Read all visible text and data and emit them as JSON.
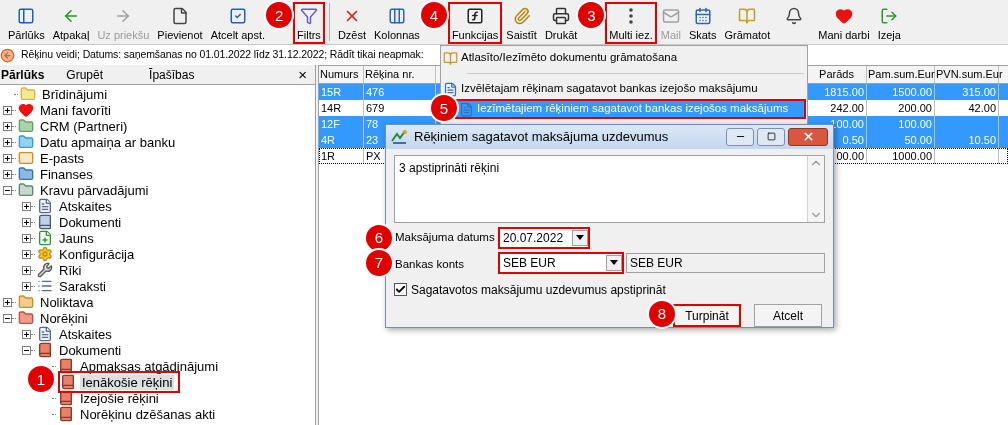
{
  "toolbar": {
    "items": [
      {
        "kind": "button",
        "label": "Pārlūks",
        "disabled": false
      },
      {
        "kind": "button",
        "label": "Atpakaļ",
        "disabled": false
      },
      {
        "kind": "button",
        "label": "Uz priekšu",
        "disabled": true
      },
      {
        "kind": "button",
        "label": "Pievienot",
        "disabled": false
      },
      {
        "kind": "button",
        "label": "Atcelt apst.",
        "disabled": false
      },
      {
        "kind": "button",
        "label": "Filtrs",
        "disabled": false,
        "callout": "2"
      },
      {
        "kind": "separator"
      },
      {
        "kind": "button",
        "label": "Dzēst",
        "disabled": false
      },
      {
        "kind": "button",
        "label": "Kolonnas",
        "disabled": false
      },
      {
        "kind": "button",
        "label": "Funkcijas",
        "disabled": false,
        "callout": "4"
      },
      {
        "kind": "button",
        "label": "Saistīt",
        "disabled": false
      },
      {
        "kind": "button",
        "label": "Drukāt",
        "disabled": false
      },
      {
        "kind": "button",
        "label": "Multi iez.",
        "disabled": false,
        "callout": "3"
      },
      {
        "kind": "button",
        "label": "Mail",
        "disabled": true
      },
      {
        "kind": "button",
        "label": "Skats",
        "disabled": false
      },
      {
        "kind": "button",
        "label": "Grāmatot",
        "disabled": false
      },
      {
        "kind": "icon_button",
        "disabled": false
      },
      {
        "kind": "button",
        "label": "Mani darbi",
        "disabled": false
      },
      {
        "kind": "button",
        "label": "Izeja",
        "disabled": false
      }
    ]
  },
  "filter_bar": {
    "text": "Rēķinu veidi; Datums: saņemšanas no 01.01.2022 līdz 31.12.2022; Rādīt tikai neapmak:"
  },
  "sidebar": {
    "tabs": [
      {
        "label": "Pārlūks",
        "selected": true
      },
      {
        "label": "Grupēt",
        "selected": false
      },
      {
        "label": "Īpašības",
        "selected": false
      }
    ],
    "close": "×",
    "tree": [
      {
        "label": "Brīdinājumi",
        "selected": false
      },
      {
        "label": "Mani favorīti",
        "expanded": false,
        "selected": false
      },
      {
        "label": "CRM (Partneri)",
        "expanded": false,
        "selected": false
      },
      {
        "label": "Datu apmaiņa ar banku",
        "expanded": false,
        "selected": false
      },
      {
        "label": "E-pasts",
        "expanded": false,
        "selected": false
      },
      {
        "label": "Finanses",
        "expanded": false,
        "selected": false
      },
      {
        "label": "Kravu pārvadājumi",
        "expanded": true,
        "selected": false,
        "children": [
          {
            "label": "Atskaites",
            "expanded": false,
            "selected": false
          },
          {
            "label": "Dokumenti",
            "expanded": false,
            "selected": false
          },
          {
            "label": "Jauns",
            "expanded": false,
            "selected": false
          },
          {
            "label": "Konfigurācija",
            "expanded": false,
            "selected": false
          },
          {
            "label": "Rīki",
            "expanded": false,
            "selected": false
          },
          {
            "label": "Saraksti",
            "expanded": false,
            "selected": false
          }
        ]
      },
      {
        "label": "Noliktava",
        "expanded": false,
        "selected": false
      },
      {
        "label": "Norēķini",
        "expanded": true,
        "selected": false,
        "children": [
          {
            "label": "Atskaites",
            "expanded": false,
            "selected": false
          },
          {
            "label": "Dokumenti",
            "expanded": true,
            "selected": false,
            "children": [
              {
                "label": "Apmaksas atgādinājumi",
                "selected": false
              },
              {
                "label": "Ienākošie rēķini",
                "selected": true,
                "callout": "1"
              },
              {
                "label": "Izejošie rēķini",
                "selected": false
              },
              {
                "label": "Norēķinu dzēšanas akti",
                "selected": false
              }
            ]
          }
        ]
      }
    ]
  },
  "table": {
    "columns": [
      "Numurs",
      "Rēķina nr.",
      "Parāds",
      "Pam.sum.Eur",
      "PVN.sum.Eur"
    ],
    "rows": [
      {
        "cells": [
          "15R",
          "476",
          "1815.00",
          "1500.00",
          "315.00"
        ],
        "selected": true,
        "focused": false
      },
      {
        "cells": [
          "14R",
          "679",
          "242.00",
          "200.00",
          "42.00"
        ],
        "selected": false,
        "focused": false
      },
      {
        "cells": [
          "12F",
          "78",
          "100.00",
          "100.00",
          null
        ],
        "selected": true,
        "focused": false
      },
      {
        "cells": [
          "4R",
          "23",
          "0.50",
          "50.00",
          "10.50"
        ],
        "selected": true,
        "focused": false
      },
      {
        "cells": [
          "1R",
          "PX",
          "00.00",
          "1000.00",
          null
        ],
        "selected": false,
        "focused": true
      }
    ]
  },
  "menu": {
    "items": [
      {
        "kind": "item",
        "label": "Atlasīto/Iezīmēto dokumentu grāmatošana",
        "selected": false
      },
      {
        "kind": "separator"
      },
      {
        "kind": "item",
        "label": "Izvēlētajam rēķinam sagatavot bankas izejošo maksājumu",
        "selected": false
      },
      {
        "kind": "item",
        "label": "Iezīmētajiem rēķiniem sagatavot bankas izejošos maksājums",
        "selected": true,
        "callout": "5"
      }
    ]
  },
  "dialog": {
    "title": "Rēķiniem sagatavot maksājuma uzdevumus",
    "memo": "3 apstiprināti rēķini",
    "date": {
      "label": "Maksājuma datums",
      "value": "20.07.2022",
      "callout": "6"
    },
    "account": {
      "label": "Bankas konts",
      "value": "SEB EUR",
      "display": "SEB EUR",
      "callout": "7"
    },
    "confirm": {
      "label": "Sagatavotos maksājumu uzdevumus apstiprināt",
      "checked": true
    },
    "buttons": [
      {
        "label": "Turpināt",
        "callout": "8"
      },
      {
        "label": "Atcelt"
      }
    ]
  }
}
